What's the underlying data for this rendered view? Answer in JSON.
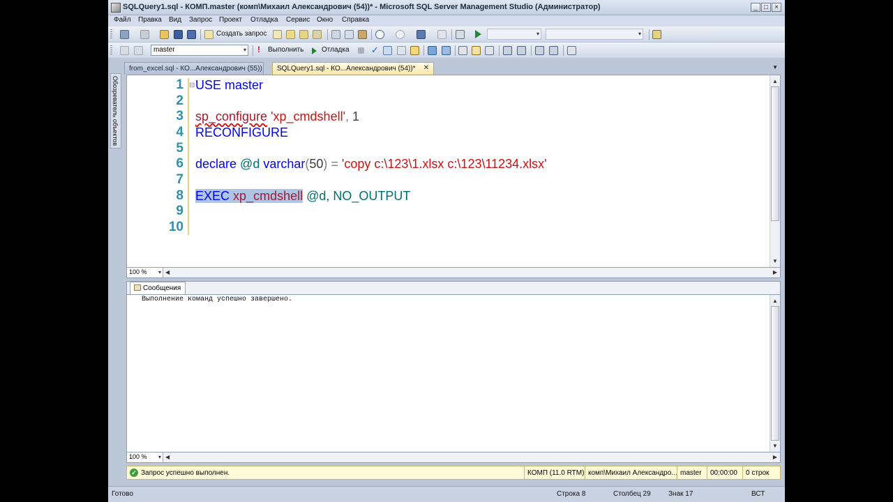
{
  "window": {
    "title": "SQLQuery1.sql - КОМП.master (комп\\Михаил Александрович (54))* - Microsoft SQL Server Management Studio (Администратор)"
  },
  "menu": [
    "Файл",
    "Правка",
    "Вид",
    "Запрос",
    "Проект",
    "Отладка",
    "Сервис",
    "Окно",
    "Справка"
  ],
  "toolbar": {
    "new_query_label": "Создать запрос",
    "database_value": "master",
    "execute_label": "Выполнить",
    "debug_label": "Отладка"
  },
  "sidebar": {
    "object_explorer_label": "Обозреватель объектов"
  },
  "tabs": [
    {
      "label": "from_excel.sql - КО...Александрович (55))",
      "active": false
    },
    {
      "label": "SQLQuery1.sql - КО...Александрович (54))*",
      "active": true
    }
  ],
  "editor": {
    "line_numbers": [
      "1",
      "2",
      "3",
      "4",
      "5",
      "6",
      "7",
      "8",
      "9",
      "10"
    ],
    "code": {
      "l1": {
        "kw": "USE",
        "rest": " master"
      },
      "l3": {
        "fn": "sp_configure",
        "str": "'xp_cmdshell'",
        "sep": ",",
        "num": " 1"
      },
      "l4": {
        "kw": "RECONFIGURE"
      },
      "l6": {
        "kw1": "declare",
        "var": " @d ",
        "type": "varchar",
        "p1": "(",
        "num": "50",
        "p2": ")",
        "eq": " = ",
        "str": "'copy c:\\123\\1.xlsx c:\\123\\11234.xlsx'"
      },
      "l8": {
        "kw": "EXEC",
        "sp": " ",
        "fn": "xp_cmdshell",
        "rest": " @d, NO_OUTPUT"
      }
    },
    "zoom": "100 %"
  },
  "results": {
    "tab_label": "Сообщения",
    "message": "Выполнение команд успешно завершено.",
    "zoom": "100 %"
  },
  "query_status": {
    "text": "Запрос успешно выполнен.",
    "server": "КОМП (11.0 RTM)",
    "user": "комп\\Михаил Александро...",
    "database": "master",
    "elapsed": "00:00:00",
    "rows": "0 строк"
  },
  "statusbar": {
    "ready": "Готово",
    "line": "Строка 8",
    "column": "Столбец 29",
    "char": "Знак 17",
    "mode": "ВСТ"
  }
}
